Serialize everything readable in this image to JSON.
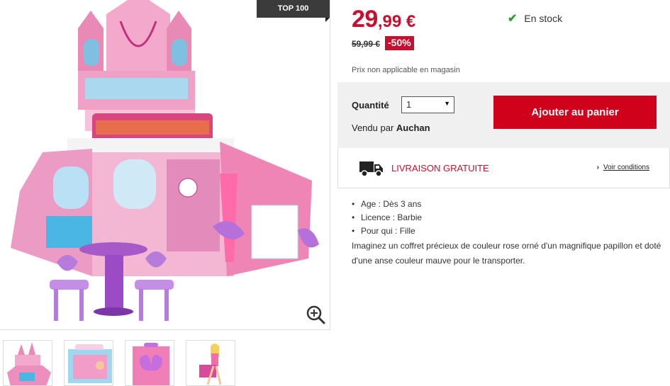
{
  "badge": "TOP 100",
  "price": {
    "integer": "29",
    "decimal": ",99 €",
    "old": "59,99 €",
    "discount": "-50%",
    "notice": "Prix non applicable en magasin"
  },
  "stock": {
    "icon": "check-icon",
    "label": "En stock"
  },
  "purchase": {
    "quantity_label": "Quantité",
    "quantity_value": "1",
    "seller_prefix": "Vendu par",
    "seller_name": "Auchan",
    "add_to_cart": "Ajouter au panier"
  },
  "delivery": {
    "icon": "truck-icon",
    "label": "LIVRAISON GRATUITE",
    "conditions_link": "Voir conditions"
  },
  "specs": [
    {
      "key": "Age",
      "value": "Dès 3 ans"
    },
    {
      "key": "Licence",
      "value": "Barbie"
    },
    {
      "key": "Pour qui",
      "value": "Fille"
    }
  ],
  "specs_text": [
    "Age :  Dès 3 ans",
    "Licence :  Barbie",
    "Pour qui :  Fille"
  ],
  "description": "Imaginez un coffret précieux de couleur rose orné d'un magnifique papillon et doté d'une anse couleur mauve pour le transporter.",
  "gallery": {
    "zoom_icon": "zoom-in-icon",
    "thumbnails": [
      "castle-playset-thumbnail",
      "boxed-product-thumbnail",
      "closed-case-thumbnail",
      "doll-carrying-case-thumbnail"
    ]
  },
  "colors": {
    "accent": "#c8102e",
    "button": "#d0021b",
    "in_stock": "#2e9e3a"
  }
}
